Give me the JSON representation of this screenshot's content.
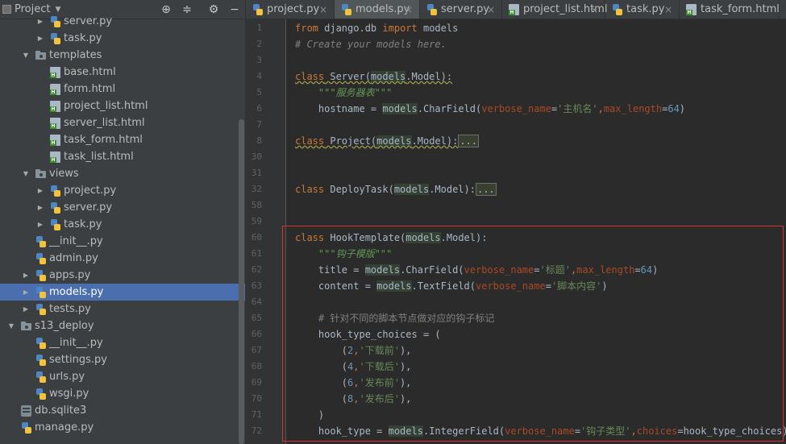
{
  "panel": {
    "title": "Project",
    "dropdown": "▼",
    "tree": [
      {
        "name": "server.py",
        "type": "py",
        "depth": 3,
        "arrow": "right"
      },
      {
        "name": "task.py",
        "type": "py",
        "depth": 3,
        "arrow": "right"
      },
      {
        "name": "templates",
        "type": "folder",
        "depth": 2,
        "arrow": "down"
      },
      {
        "name": "base.html",
        "type": "html",
        "depth": 3,
        "arrow": ""
      },
      {
        "name": "form.html",
        "type": "html",
        "depth": 3,
        "arrow": ""
      },
      {
        "name": "project_list.html",
        "type": "html",
        "depth": 3,
        "arrow": ""
      },
      {
        "name": "server_list.html",
        "type": "html",
        "depth": 3,
        "arrow": ""
      },
      {
        "name": "task_form.html",
        "type": "html",
        "depth": 3,
        "arrow": ""
      },
      {
        "name": "task_list.html",
        "type": "html",
        "depth": 3,
        "arrow": ""
      },
      {
        "name": "views",
        "type": "folder",
        "depth": 2,
        "arrow": "down"
      },
      {
        "name": "project.py",
        "type": "py",
        "depth": 3,
        "arrow": "right"
      },
      {
        "name": "server.py",
        "type": "py",
        "depth": 3,
        "arrow": "right"
      },
      {
        "name": "task.py",
        "type": "py",
        "depth": 3,
        "arrow": "right"
      },
      {
        "name": "__init__.py",
        "type": "py",
        "depth": 2,
        "arrow": ""
      },
      {
        "name": "admin.py",
        "type": "py",
        "depth": 2,
        "arrow": ""
      },
      {
        "name": "apps.py",
        "type": "py",
        "depth": 2,
        "arrow": "right"
      },
      {
        "name": "models.py",
        "type": "py",
        "depth": 2,
        "arrow": "right",
        "selected": true
      },
      {
        "name": "tests.py",
        "type": "py",
        "depth": 2,
        "arrow": "right"
      },
      {
        "name": "s13_deploy",
        "type": "folder",
        "depth": 1,
        "arrow": "down"
      },
      {
        "name": "__init__.py",
        "type": "py",
        "depth": 2,
        "arrow": ""
      },
      {
        "name": "settings.py",
        "type": "py",
        "depth": 2,
        "arrow": ""
      },
      {
        "name": "urls.py",
        "type": "py",
        "depth": 2,
        "arrow": ""
      },
      {
        "name": "wsgi.py",
        "type": "py",
        "depth": 2,
        "arrow": ""
      },
      {
        "name": "db.sqlite3",
        "type": "db",
        "depth": 1,
        "arrow": ""
      },
      {
        "name": "manage.py",
        "type": "py",
        "depth": 1,
        "arrow": ""
      }
    ]
  },
  "tabs": [
    {
      "label": "project.py",
      "type": "py",
      "active": false
    },
    {
      "label": "models.py",
      "type": "py",
      "active": true
    },
    {
      "label": "server.py",
      "type": "py",
      "active": false
    },
    {
      "label": "project_list.html",
      "type": "html",
      "active": false
    },
    {
      "label": "task.py",
      "type": "py",
      "active": false
    },
    {
      "label": "task_form.html",
      "type": "html",
      "active": false
    }
  ],
  "tab_close_glyph": "×",
  "line_numbers": [
    "1",
    "2",
    "3",
    "4",
    "5",
    "6",
    "7",
    "8",
    "30",
    "31",
    "32",
    "58",
    "59",
    "60",
    "61",
    "62",
    "63",
    "64",
    "65",
    "66",
    "67",
    "68",
    "69",
    "70",
    "71",
    "72"
  ],
  "code": {
    "l1_from": "from",
    "l1_mod": " django.db ",
    "l1_import": "import",
    "l1_models": "models",
    "l2": "# Create your models here.",
    "l4_class": "class",
    "l4_name": " Server(",
    "l4_models": "models",
    "l4_rest": ".Model):",
    "l5_doc": "\"\"\"服务器表\"\"\"",
    "l6_a": "hostname = ",
    "l6_models": "models",
    "l6_b": ".CharField(",
    "l6_p1": "verbose_name",
    "l6_eq1": "=",
    "l6_s1": "'主机名'",
    "l6_p2": "max_length",
    "l6_eq2": "=",
    "l6_n": "64",
    "l6_close": ")",
    "l8_class": "class",
    "l8_name": " Project(",
    "l8_models": "models",
    "l8_rest": ".Model):",
    "l8_fold": "...",
    "l32_class": "class",
    "l32_name": " DeployTask(",
    "l32_models": "models",
    "l32_rest": ".Model):",
    "l32_fold": "...",
    "l60_class": "class",
    "l60_name": " HookTemplate(",
    "l60_models": "models",
    "l60_rest": ".Model):",
    "l61_doc": "\"\"\"钩子模版\"\"\"",
    "l62_a": "title = ",
    "l62_models": "models",
    "l62_b": ".CharField(",
    "l62_p1": "verbose_name",
    "l62_eq1": "=",
    "l62_s1": "'标题'",
    "l62_p2": "max_length",
    "l62_eq2": "=",
    "l62_n": "64",
    "l62_close": ")",
    "l63_a": "content = ",
    "l63_models": "models",
    "l63_b": ".TextField(",
    "l63_p1": "verbose_name",
    "l63_eq1": "=",
    "l63_s1": "'脚本内容'",
    "l63_close": ")",
    "l65": "# 针对不同的脚本节点做对应的钩子标记",
    "l66": "hook_type_choices = (",
    "l67_a": "(",
    "l67_n": "2",
    "l67_s": "'下载前'",
    "l67_b": "),",
    "l68_a": "(",
    "l68_n": "4",
    "l68_s": "'下载后'",
    "l68_b": "),",
    "l69_a": "(",
    "l69_n": "6",
    "l69_s": "'发布前'",
    "l69_b": "),",
    "l70_a": "(",
    "l70_n": "8",
    "l70_s": "'发布后'",
    "l70_b": "),",
    "l71": ")",
    "l72_a": "hook_type = ",
    "l72_models": "models",
    "l72_b": ".IntegerField(",
    "l72_p1": "verbose_name",
    "l72_eq1": "=",
    "l72_s1": "'钩子类型'",
    "l72_p2": "choices",
    "l72_eq2": "=",
    "l72_c": "hook_type_choices)",
    "comma": ","
  },
  "colors": {
    "highlight_box": "#d9302b",
    "selection": "#4b6eaf"
  }
}
